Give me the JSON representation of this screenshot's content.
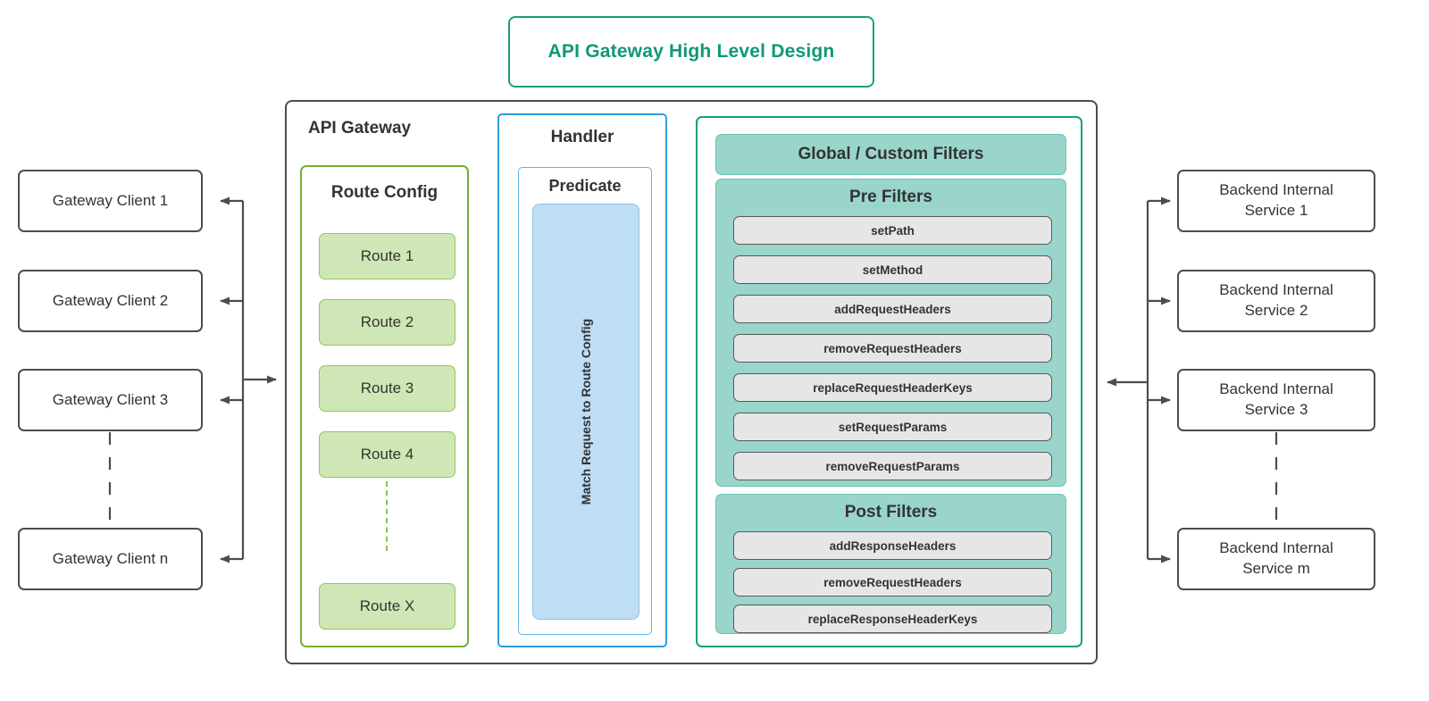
{
  "title": {
    "text": "API Gateway High Level Design",
    "color": "#0e9977"
  },
  "gateway": {
    "label": "API Gateway",
    "border_color": "#4d4d4d"
  },
  "clients": {
    "items": [
      {
        "label": "Gateway Client 1"
      },
      {
        "label": "Gateway Client 2"
      },
      {
        "label": "Gateway Client 3"
      },
      {
        "label": "Gateway Client n"
      }
    ]
  },
  "backends": {
    "items": [
      {
        "line1": "Backend Internal",
        "line2": "Service 1"
      },
      {
        "line1": "Backend Internal",
        "line2": "Service 2"
      },
      {
        "line1": "Backend Internal",
        "line2": "Service 3"
      },
      {
        "line1": "Backend Internal",
        "line2": "Service m"
      }
    ]
  },
  "route_config": {
    "title": "Route Config",
    "accent_color": "#71b036",
    "fill_color": "#cfe7b6",
    "routes": [
      {
        "label": "Route 1"
      },
      {
        "label": "Route 2"
      },
      {
        "label": "Route 3"
      },
      {
        "label": "Route 4"
      },
      {
        "label": "Route X"
      }
    ]
  },
  "handler": {
    "title": "Handler",
    "accent_color": "#2d9cdb",
    "predicate": {
      "title": "Predicate",
      "inner_label": "Match Request to Route Config",
      "fill_color": "#bfddf4"
    }
  },
  "filters": {
    "accent_color": "#159e7e",
    "panel_fill": "#99d5cb",
    "item_fill": "#e6e6e6",
    "global": {
      "title": "Global / Custom Filters"
    },
    "pre": {
      "title": "Pre Filters",
      "items": [
        {
          "label": "setPath"
        },
        {
          "label": "setMethod"
        },
        {
          "label": "addRequestHeaders"
        },
        {
          "label": "removeRequestHeaders"
        },
        {
          "label": "replaceRequestHeaderKeys"
        },
        {
          "label": "setRequestParams"
        },
        {
          "label": "removeRequestParams"
        }
      ]
    },
    "post": {
      "title": "Post Filters",
      "items": [
        {
          "label": "addResponseHeaders"
        },
        {
          "label": "removeRequestHeaders"
        },
        {
          "label": "replaceResponseHeaderKeys"
        }
      ]
    }
  }
}
